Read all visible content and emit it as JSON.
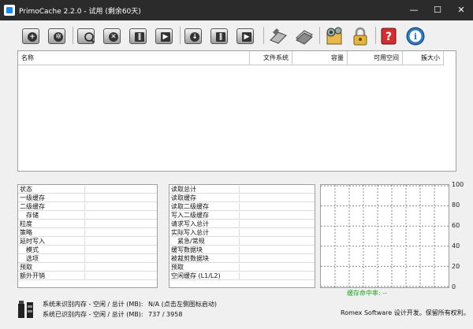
{
  "window": {
    "title": "PrimoCache 2.2.0 - 试用 (剩余60天)",
    "controls": {
      "minimize": "—",
      "maximize": "☐",
      "close": "✕"
    }
  },
  "toolbar": {
    "buttons": [
      {
        "icon": "add-cache-icon",
        "glyph": "+"
      },
      {
        "icon": "drive-settings-icon",
        "glyph": "✲"
      },
      {
        "icon": "search-drive-icon",
        "glyph": ""
      },
      {
        "icon": "delete-cache-icon",
        "glyph": "✕"
      },
      {
        "icon": "pause-cache-icon",
        "glyph": "∥"
      },
      {
        "icon": "resume-cache-icon",
        "glyph": "▶"
      },
      {
        "icon": "export-down-icon",
        "glyph": "↓"
      },
      {
        "icon": "pause-all-icon",
        "glyph": "∥"
      },
      {
        "icon": "resume-all-icon",
        "glyph": "▶"
      },
      {
        "icon": "tools-icon",
        "glyph": ""
      },
      {
        "icon": "license-icon",
        "glyph": ""
      },
      {
        "icon": "preferences-icon",
        "glyph": ""
      },
      {
        "icon": "lock-icon",
        "glyph": ""
      },
      {
        "icon": "help-icon",
        "glyph": "?"
      },
      {
        "icon": "info-icon",
        "glyph": "i"
      }
    ]
  },
  "volume_list": {
    "columns": [
      "名称",
      "文件系统",
      "容量",
      "可用空间",
      "簇大小"
    ]
  },
  "stats_left": {
    "rows": [
      "状态",
      "一级缓存",
      "二级缓存",
      "存储",
      "粒度",
      "策略",
      "延时写入",
      "模式",
      "选项",
      "预取",
      "额外开销"
    ]
  },
  "stats_right": {
    "rows": [
      "读取总计",
      "读取缓存",
      "读取二级缓存",
      "写入二级缓存",
      "请求写入总计",
      "实际写入总计",
      "紧急/常规",
      "缓写数据块",
      "被裁剪数据块",
      "预取",
      "空闲缓存 (L1/L2)"
    ]
  },
  "hit_chart": {
    "y_ticks": [
      "100",
      "80",
      "60",
      "40",
      "20",
      "0"
    ],
    "label": "缓存命中率: --"
  },
  "footer": {
    "unrecognized_label": "系统未识别内存 - 空闲 / 总计 (MB):",
    "unrecognized_value": "N/A (点击左侧图标启动)",
    "recognized_label": "系统已识别内存 - 空闲 / 总计 (MB):",
    "recognized_value": "737 / 3958",
    "copyright": "Romex Software 设计开发。保留所有权利。"
  },
  "chart_data": {
    "type": "line",
    "title": "",
    "xlabel": "",
    "ylabel": "",
    "ylim": [
      0,
      100
    ],
    "y_ticks": [
      0,
      20,
      40,
      60,
      80,
      100
    ],
    "grid": true,
    "series": []
  }
}
